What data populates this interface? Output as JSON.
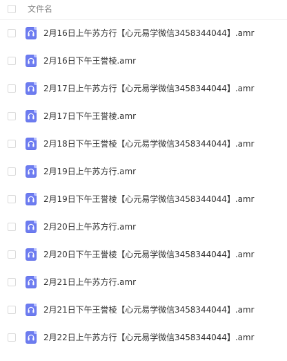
{
  "header": {
    "column_label": "文件名"
  },
  "files": [
    {
      "name": "2月16日上午苏方行【心元易学微信3458344044】.amr"
    },
    {
      "name": "2月16日下午王誉棱.amr"
    },
    {
      "name": "2月17日上午苏方行【心元易学微信3458344044】.amr"
    },
    {
      "name": "2月17日下午王誉棱.amr"
    },
    {
      "name": "2月18日下午王誉棱【心元易学微信3458344044】.amr"
    },
    {
      "name": "2月19日上午苏方行.amr"
    },
    {
      "name": "2月19日下午王誉棱【心元易学微信3458344044】.amr"
    },
    {
      "name": "2月20日上午苏方行.amr"
    },
    {
      "name": "2月20日下午王誉棱【心元易学微信3458344044】.amr"
    },
    {
      "name": "2月21日上午苏方行.amr"
    },
    {
      "name": "2月21日下午王誉棱【心元易学微信3458344044】.amr"
    },
    {
      "name": "2月22日上午苏方行【心元易学微信3458344044】.amr"
    }
  ],
  "icon": {
    "name": "audio-file-icon",
    "color": "#6d7cf0"
  }
}
